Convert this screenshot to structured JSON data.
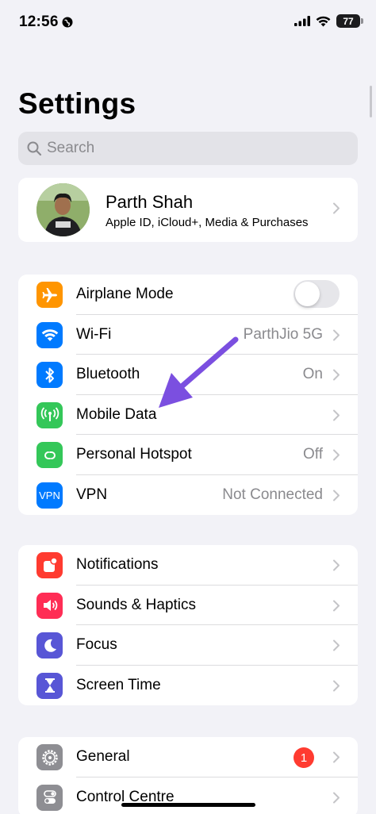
{
  "status_bar": {
    "time": "12:56",
    "battery": "77"
  },
  "header": {
    "title": "Settings"
  },
  "search": {
    "placeholder": "Search"
  },
  "profile": {
    "name": "Parth Shah",
    "subtitle": "Apple ID, iCloud+, Media & Purchases"
  },
  "connectivity": [
    {
      "label": "Airplane Mode",
      "icon": "airplane-icon",
      "color": "#ff9500",
      "toggle": false
    },
    {
      "label": "Wi-Fi",
      "icon": "wifi-icon",
      "color": "#007aff",
      "value": "ParthJio 5G"
    },
    {
      "label": "Bluetooth",
      "icon": "bluetooth-icon",
      "color": "#007aff",
      "value": "On"
    },
    {
      "label": "Mobile Data",
      "icon": "antenna-icon",
      "color": "#34c759",
      "value": ""
    },
    {
      "label": "Personal Hotspot",
      "icon": "hotspot-icon",
      "color": "#34c759",
      "value": "Off"
    },
    {
      "label": "VPN",
      "icon": "vpn-icon",
      "icon_text": "VPN",
      "color": "#007aff",
      "value": "Not Connected"
    }
  ],
  "notifications_group": [
    {
      "label": "Notifications",
      "icon": "notification-bell-icon",
      "color": "#ff3b30"
    },
    {
      "label": "Sounds & Haptics",
      "icon": "speaker-icon",
      "color": "#ff2d55"
    },
    {
      "label": "Focus",
      "icon": "moon-icon",
      "color": "#5856d6"
    },
    {
      "label": "Screen Time",
      "icon": "hourglass-icon",
      "color": "#5856d6"
    }
  ],
  "general_group": [
    {
      "label": "General",
      "icon": "gear-icon",
      "color": "#8e8e93",
      "badge": "1"
    },
    {
      "label": "Control Centre",
      "icon": "toggles-icon",
      "color": "#8e8e93"
    }
  ],
  "annotation": {
    "arrow_color": "#7b4fe0"
  }
}
